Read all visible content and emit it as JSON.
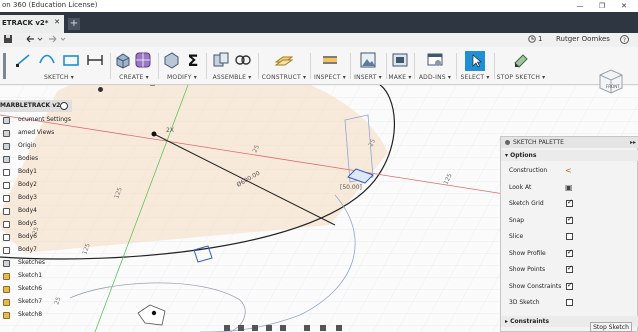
{
  "window": {
    "title": "on 360 (Education License)",
    "minimize": "—",
    "maximize": "❐",
    "close": "✕"
  },
  "tab": {
    "label": "ETRACK v2*",
    "close": "✕",
    "new_tab": "+"
  },
  "quick_access": {
    "clock_count": "1",
    "user_name": "Rutger Oomkes",
    "help": "?"
  },
  "ribbon": {
    "groups": [
      "SKETCH ▾",
      "CREATE ▾",
      "MODIFY ▾",
      "ASSEMBLE ▾",
      "CONSTRUCT ▾",
      "INSPECT ▾",
      "INSERT ▾",
      "MAKE ▾",
      "ADD-INS ▾",
      "SELECT ▾",
      "STOP SKETCH ▾"
    ],
    "accent": "#1f8fd6"
  },
  "browser": {
    "root": "MARBLETRACK v2",
    "items": [
      {
        "label": "ocument Settings",
        "kind": "folder"
      },
      {
        "label": "amed Views",
        "kind": "folder"
      },
      {
        "label": "Origin",
        "kind": "folder"
      },
      {
        "label": "Bodies",
        "kind": "folder"
      },
      {
        "label": "Body1",
        "kind": "body"
      },
      {
        "label": "Body2",
        "kind": "body"
      },
      {
        "label": "Body3",
        "kind": "body"
      },
      {
        "label": "Body4",
        "kind": "body"
      },
      {
        "label": "Body5",
        "kind": "body"
      },
      {
        "label": "Body6",
        "kind": "body"
      },
      {
        "label": "Body7",
        "kind": "body"
      },
      {
        "label": "Sketches",
        "kind": "folder"
      },
      {
        "label": "Sketch1",
        "kind": "sketch"
      },
      {
        "label": "Sketch6",
        "kind": "sketch"
      },
      {
        "label": "Sketch7",
        "kind": "sketch"
      },
      {
        "label": "Sketch8",
        "kind": "sketch"
      }
    ]
  },
  "canvas": {
    "dimensions": [
      "2X",
      "Ø600.00",
      "25",
      "[50.00]",
      "125",
      "125",
      "125",
      "25",
      "25",
      "25"
    ]
  },
  "viewcube": {
    "face": "FRONT"
  },
  "sketch_palette": {
    "title": "SKETCH PALETTE",
    "options_header": "▾ Options",
    "options": [
      {
        "label": "Construction",
        "type": "icon",
        "icon": "construction-icon"
      },
      {
        "label": "Look At",
        "type": "icon",
        "icon": "look-at-icon"
      },
      {
        "label": "Sketch Grid",
        "type": "check",
        "checked": true
      },
      {
        "label": "Snap",
        "type": "check",
        "checked": true
      },
      {
        "label": "Slice",
        "type": "check",
        "checked": false
      },
      {
        "label": "Show Profile",
        "type": "check",
        "checked": true
      },
      {
        "label": "Show Points",
        "type": "check",
        "checked": true
      },
      {
        "label": "Show Constraints",
        "type": "check",
        "checked": true
      },
      {
        "label": "3D Sketch",
        "type": "check",
        "checked": false
      }
    ],
    "constraints_header": "▸ Constraints",
    "stop_button": "Stop Sketch"
  }
}
